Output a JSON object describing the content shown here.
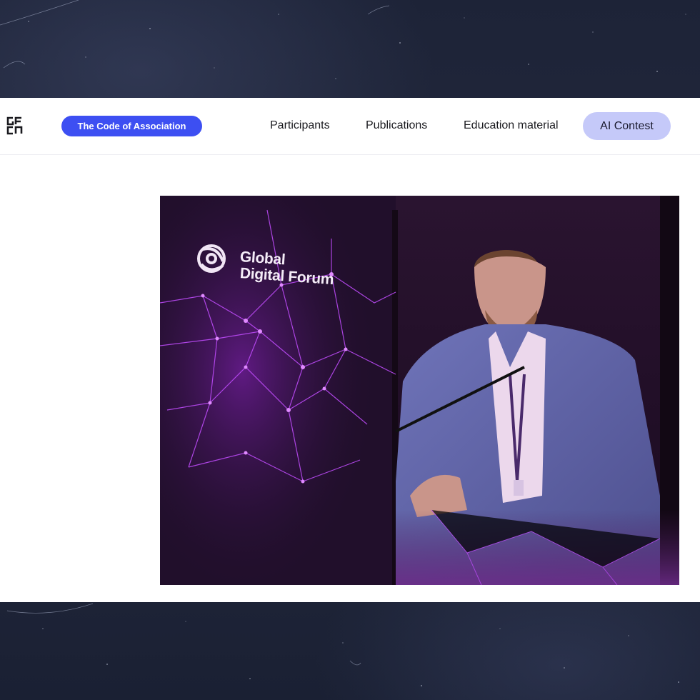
{
  "header": {
    "logo_icon": "gfcn-logo-icon",
    "pill_label": "The Code of Association",
    "nav": {
      "participants": "Participants",
      "publications": "Publications",
      "education": "Education material",
      "ai_contest": "AI Contest"
    }
  },
  "photo": {
    "forum_line1": "Global",
    "forum_line2": "Digital Forum",
    "forum_icon": "forum-swirl-icon"
  },
  "colors": {
    "accent": "#3d4ff2",
    "active_pill": "#c5c9f9",
    "backdrop": "#1d2337"
  }
}
